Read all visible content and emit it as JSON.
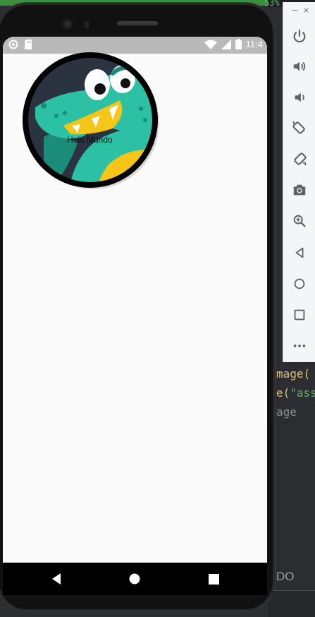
{
  "ide": {
    "battery_percent": "53%",
    "code_lines": [
      "mage(",
      "e(",
      "\"ass",
      "age"
    ],
    "bottom_text": "DO"
  },
  "emulator_toolbar": {
    "minimize": "−",
    "close": "×",
    "buttons": [
      {
        "icon": "power-icon"
      },
      {
        "icon": "volume-up-icon"
      },
      {
        "icon": "volume-down-icon"
      },
      {
        "icon": "rotate-left-icon"
      },
      {
        "icon": "rotate-right-icon"
      },
      {
        "icon": "camera-icon"
      },
      {
        "icon": "zoom-icon"
      },
      {
        "icon": "back-icon"
      },
      {
        "icon": "home-icon"
      },
      {
        "icon": "overview-icon"
      },
      {
        "icon": "more-icon"
      }
    ]
  },
  "status_bar": {
    "time": "11:4"
  },
  "app": {
    "avatar_caption": "Hola Mundo"
  },
  "colors": {
    "dino_green": "#2cc1a4",
    "dino_dark": "#1b8c7a",
    "dino_yellow": "#f5c518",
    "avatar_bg": "#2c3340"
  }
}
